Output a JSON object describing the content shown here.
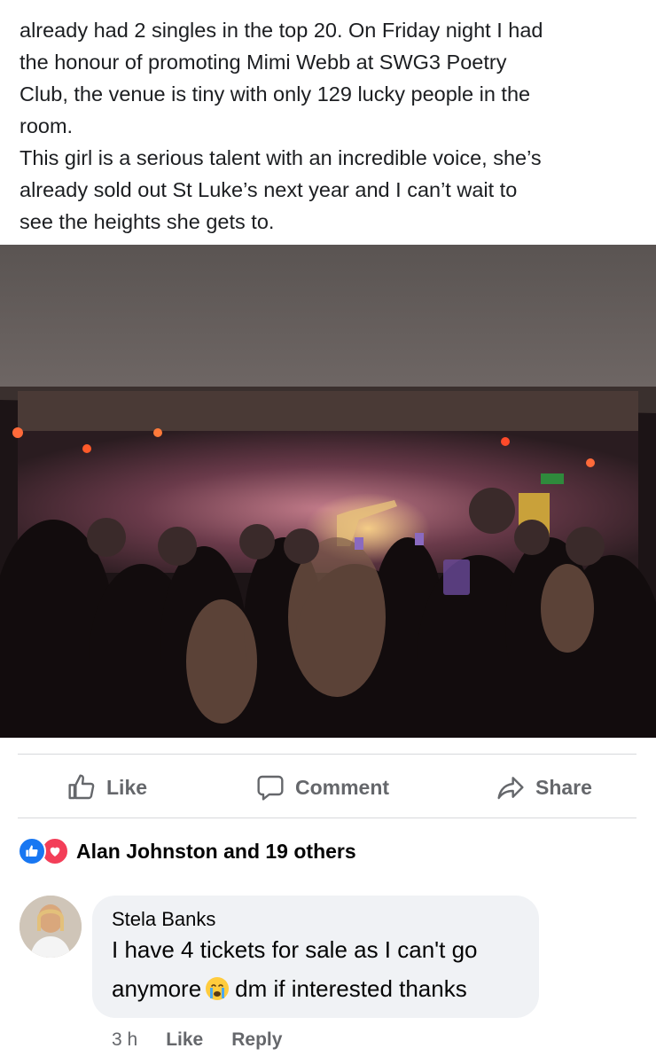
{
  "post": {
    "text_lines": [
      "already had 2 singles in the top 20. On Friday night I had",
      "the honour of promoting Mimi Webb at SWG3 Poetry",
      "Club, the venue is tiny with only 129 lucky people in the",
      "room.",
      "This girl is a serious talent with an incredible voice, she’s",
      "already sold out St Luke’s next year and I can’t wait to",
      "see the heights she gets to."
    ]
  },
  "actions": {
    "like": "Like",
    "comment": "Comment",
    "share": "Share"
  },
  "reactions": {
    "label": "Alan Johnston and 19 others",
    "types": [
      "like-icon",
      "love-icon"
    ]
  },
  "comment": {
    "author": "Stela Banks",
    "line1": "I have 4 tickets for sale as I can't go",
    "line2_before": "anymore",
    "line2_after": "dm if interested thanks",
    "emoji": "crying-face-emoji",
    "time": "3 h",
    "like": "Like",
    "reply": "Reply"
  },
  "colors": {
    "accent": "#1877f2",
    "love": "#f33e58",
    "muted_text": "#65676b",
    "bubble_bg": "#f0f2f5"
  }
}
